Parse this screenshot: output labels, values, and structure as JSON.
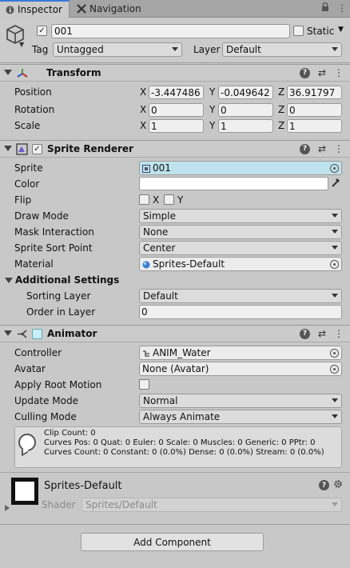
{
  "tabs": [
    {
      "label": "Inspector",
      "icon": "info-icon"
    },
    {
      "label": "Navigation",
      "icon": "navigation-icon"
    }
  ],
  "object": {
    "active": true,
    "name": "001",
    "static_label": "Static",
    "static_checked": false,
    "tag_label": "Tag",
    "tag_value": "Untagged",
    "layer_label": "Layer",
    "layer_value": "Default"
  },
  "transform": {
    "title": "Transform",
    "rows": [
      {
        "label": "Position",
        "x": "-3.447486",
        "y": "-0.049642",
        "z": "36.91797"
      },
      {
        "label": "Rotation",
        "x": "0",
        "y": "0",
        "z": "0"
      },
      {
        "label": "Scale",
        "x": "1",
        "y": "1",
        "z": "1"
      }
    ],
    "axis": {
      "x": "X",
      "y": "Y",
      "z": "Z"
    }
  },
  "sprite_renderer": {
    "title": "Sprite Renderer",
    "enabled": true,
    "sprite_label": "Sprite",
    "sprite_value": "001",
    "color_label": "Color",
    "color_value": "#ffffff",
    "flip_label": "Flip",
    "flip_x": "X",
    "flip_y": "Y",
    "draw_mode_label": "Draw Mode",
    "draw_mode_value": "Simple",
    "mask_label": "Mask Interaction",
    "mask_value": "None",
    "sort_point_label": "Sprite Sort Point",
    "sort_point_value": "Center",
    "material_label": "Material",
    "material_value": "Sprites-Default",
    "additional_label": "Additional Settings",
    "sorting_layer_label": "Sorting Layer",
    "sorting_layer_value": "Default",
    "order_label": "Order in Layer",
    "order_value": "0"
  },
  "animator": {
    "title": "Animator",
    "controller_label": "Controller",
    "controller_value": "ANIM_Water",
    "avatar_label": "Avatar",
    "avatar_value": "None (Avatar)",
    "root_motion_label": "Apply Root Motion",
    "update_mode_label": "Update Mode",
    "update_mode_value": "Normal",
    "culling_label": "Culling Mode",
    "culling_value": "Always Animate",
    "info_lines": [
      "Clip Count: 0",
      "Curves Pos: 0 Quat: 0 Euler: 0 Scale: 0 Muscles: 0 Generic: 0 PPtr: 0",
      "Curves Count: 0 Constant: 0 (0.0%) Dense: 0 (0.0%) Stream: 0 (0.0%)"
    ]
  },
  "material": {
    "name": "Sprites-Default",
    "shader_label": "Shader",
    "shader_value": "Sprites/Default"
  },
  "add_component_label": "Add Component"
}
